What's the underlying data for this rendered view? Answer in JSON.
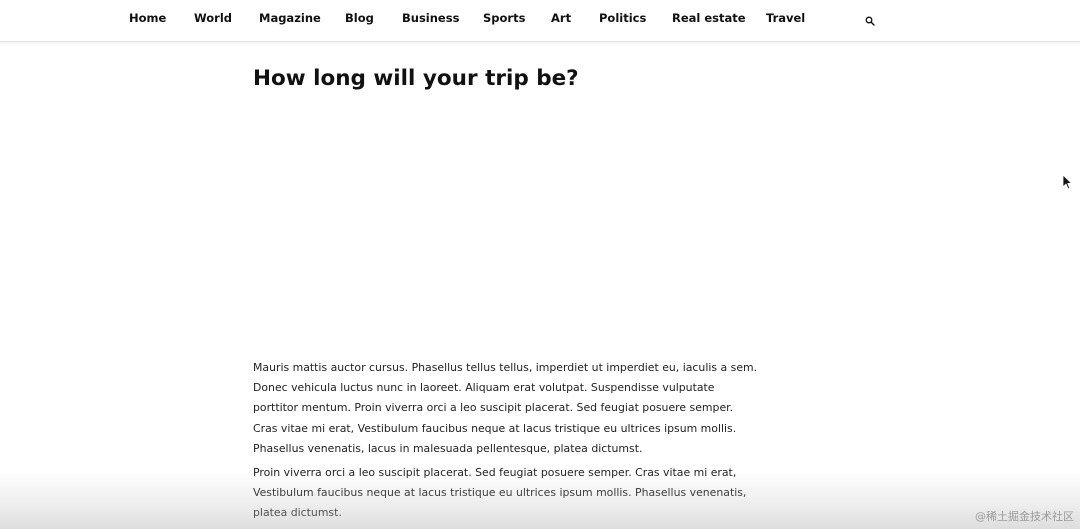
{
  "nav": {
    "items": [
      {
        "label": "Home"
      },
      {
        "label": "World"
      },
      {
        "label": "Magazine"
      },
      {
        "label": "Blog"
      },
      {
        "label": "Business"
      },
      {
        "label": "Sports"
      },
      {
        "label": "Art"
      },
      {
        "label": "Politics"
      },
      {
        "label": "Real estate"
      },
      {
        "label": "Travel"
      }
    ],
    "search_icon": "search-icon"
  },
  "article": {
    "title": "How long will your trip be?",
    "paragraphs": [
      "Mauris mattis auctor cursus. Phasellus tellus tellus, imperdiet ut imperdiet eu, iaculis a sem. Donec vehicula luctus nunc in laoreet. Aliquam erat volutpat. Suspendisse vulputate porttitor mentum. Proin viverra orci a leo suscipit placerat. Sed feugiat posuere semper. Cras vitae mi erat, Vestibulum faucibus neque at lacus tristique eu ultrices ipsum mollis. Phasellus venenatis, lacus in malesuada pellentesque, platea dictumst.",
      "Proin viverra orci a leo suscipit placerat. Sed feugiat posuere semper. Cras vitae mi erat, Vestibulum faucibus neque at lacus tristique eu ultrices ipsum mollis. Phasellus venenatis, platea dictumst."
    ]
  },
  "watermark": "@稀土掘金技术社区",
  "icons": {
    "cursor": "mouse-pointer-icon"
  }
}
